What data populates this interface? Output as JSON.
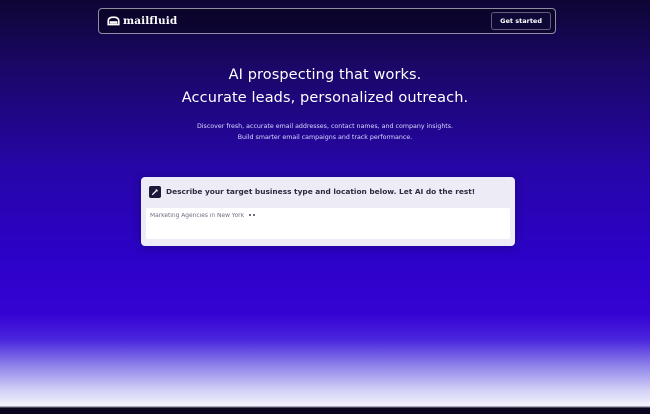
{
  "nav": {
    "brand": "mailfluid",
    "cta_label": "Get started"
  },
  "hero": {
    "headline_line1": "AI prospecting that works.",
    "headline_line2": "Accurate leads, personalized outreach.",
    "subtext_line1": "Discover fresh, accurate email addresses, contact names, and company insights.",
    "subtext_line2": "Build smarter email campaigns and track performance."
  },
  "prompt_card": {
    "title": "Describe your target business type and location below. Let AI do the rest!",
    "placeholder": "Marketing Agencies in New York",
    "icon": "edit-icon"
  },
  "colors": {
    "accent": "#2c02c8",
    "card_bg": "#edebf5",
    "nav_button_bg": "#0e0836"
  }
}
